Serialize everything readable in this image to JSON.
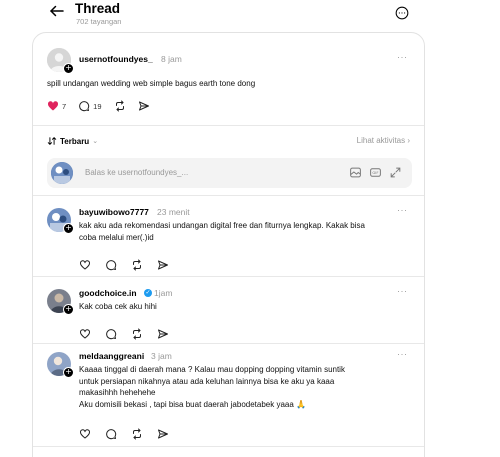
{
  "header": {
    "title": "Thread",
    "views": "702 tayangan"
  },
  "post": {
    "username": "usernotfoundyes_",
    "time": "8 jam",
    "text": "spill undangan wedding web simple bagus earth tone dong",
    "likes": "7",
    "comments": "19",
    "liked_color": "#e0245e"
  },
  "sort": {
    "label": "Terbaru",
    "activity": "Lihat aktivitas"
  },
  "reply": {
    "placeholder": "Balas ke usernotfoundyes_..."
  },
  "comments": [
    {
      "username": "bayuwibowo7777",
      "time": "23 menit",
      "lines": [
        "kak aku ada rekomendasi undangan digital free dan fiturnya lengkap. Kakak bisa",
        "coba melalui mer(.)id"
      ]
    },
    {
      "username": "goodchoice.in",
      "time": "1jam",
      "lines": [
        "Kak coba cek aku hihi"
      ]
    },
    {
      "username": "meldaanggreani",
      "time": "3 jam",
      "lines": [
        "Kaaaa tinggal di daerah mana ? Kalau mau dopping dopping vitamin suntik",
        "untuk persiapan nikahnya atau ada keluhan lainnya bisa ke aku ya kaaa",
        "makasihhh hehehehe",
        "Aku domisili bekasi , tapi bisa buat daerah jabodetabek yaaa 🙏"
      ]
    }
  ],
  "icons": {
    "back": "arrow-left-icon",
    "more": "more-circle-icon",
    "like": "heart-icon",
    "comment": "comment-bubble-icon",
    "repost": "repost-icon",
    "share": "send-icon",
    "sort": "sort-arrows-icon",
    "gif": "gif-icon",
    "image": "image-icon",
    "expand": "expand-icon"
  }
}
